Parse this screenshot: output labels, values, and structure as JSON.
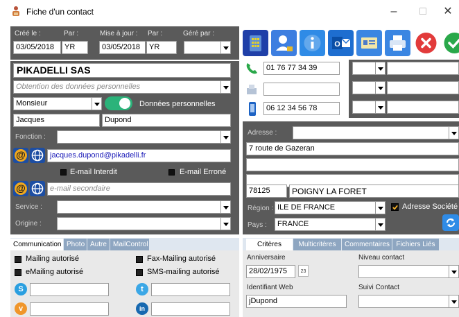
{
  "window": {
    "title": "Fiche d'un contact",
    "minimize": "–",
    "maximize": "□",
    "close": "✕"
  },
  "meta": {
    "created_label": "Créé le :",
    "created_value": "03/05/2018",
    "by_label": "Par :",
    "created_by": "YR",
    "updated_label": "Mise à jour :",
    "updated_value": "03/05/2018",
    "updated_by_label": "Par :",
    "updated_by": "YR",
    "managed_label": "Géré par :",
    "managed_value": ""
  },
  "toolbar": {
    "buttons": [
      "phone-directory",
      "contact-lock",
      "info",
      "outlook",
      "card",
      "print",
      "delete",
      "validate"
    ],
    "outlook_text": "O"
  },
  "contact": {
    "company": "PIKADELLI SAS",
    "consent_placeholder": "Obtention des données personnelles",
    "civility": "Monsieur",
    "personal_data_label": "Données personnelles",
    "first_name": "Jacques",
    "last_name": "Dupond",
    "function_label": "Fonction :",
    "function_value": "",
    "email": "jacques.dupond@pikadelli.fr",
    "email_forbidden_label": "E-mail Interdit",
    "email_error_label": "E-mail Erroné",
    "email2_placeholder": "e-mail secondaire",
    "service_label": "Service :",
    "origin_label": "Origine :",
    "at_symbol": "@"
  },
  "phones": {
    "phone1": "01 76 77 34 39",
    "fax": "",
    "mobile": "06 12 34 56 78"
  },
  "address": {
    "label": "Adresse :",
    "line1": "7 route de Gazeran",
    "line2": "",
    "line3": "",
    "postcode": "78125",
    "city": "POIGNY LA FORET",
    "region_label": "Région :",
    "region": "ILE DE FRANCE",
    "company_address_label": "Adresse Société",
    "country_label": "Pays :",
    "country": "FRANCE"
  },
  "left_tabs": {
    "tabs": [
      "Communication",
      "Photo",
      "Autre",
      "MailControl"
    ],
    "mailing": "Mailing autorisé",
    "fax_mailing": "Fax-Mailing autorisé",
    "emailing": "eMailing autorisé",
    "sms_mailing": "SMS-mailing autorisé"
  },
  "right_tabs": {
    "tabs": [
      "Critères",
      "Multicritères",
      "Commentaires",
      "Fichiers Liés"
    ],
    "birthday_label": "Anniversaire",
    "birthday": "28/02/1975",
    "calendar_day": "23",
    "contact_level_label": "Niveau contact",
    "web_id_label": "Identifiant Web",
    "web_id": "jDupond",
    "followup_label": "Suivi Contact"
  },
  "colors": {
    "dark_panel": "#5a5a5a",
    "accent_blue": "#3a86d8",
    "toggle_green": "#2bb37a",
    "tab_blue": "#8ea6c1",
    "delete_red": "#e23b3b",
    "validate_green": "#2aa84a"
  }
}
